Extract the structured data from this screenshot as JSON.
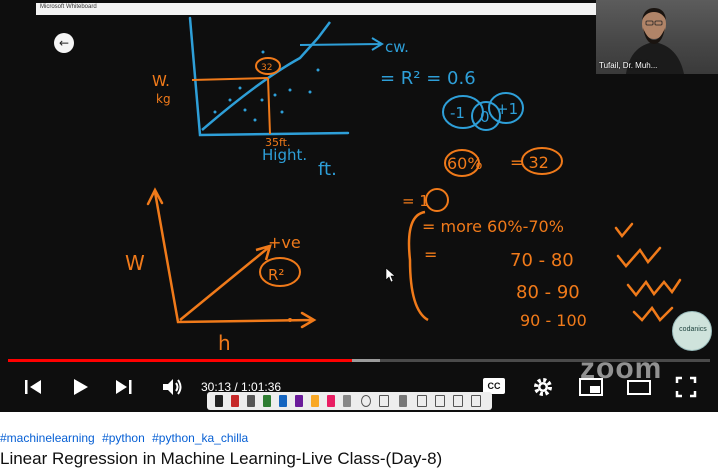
{
  "whiteboard": {
    "window_title": "Microsoft Whiteboard",
    "annotations": {
      "graph1_y_label": "W.",
      "graph1_y_unit": "kg",
      "point_label": "32",
      "x_mark": "35ft.",
      "x_label": "Hight.",
      "x_unit": "ft.",
      "arrow_label": "cw.",
      "r2_equation": "= R² = 0.6",
      "range_neg": "-1",
      "range_zero": "0",
      "range_pos": "+1",
      "percent": "60%",
      "percent_value": "= 32",
      "eq_marker": "= 1",
      "more_line": "= more 60%-70%",
      "row_70": "70 - 80",
      "row_80": "80 - 90",
      "row_90": "90 - 100",
      "graph2_y_label": "W",
      "graph2_x_label": "h",
      "trend_label": "+ve",
      "r2_short": "R²"
    }
  },
  "webcam": {
    "participant_name": "Tufail, Dr. Muh..."
  },
  "watermark": {
    "zoom": "zoom",
    "logo_text": "codanics"
  },
  "player": {
    "current_time": "30:13",
    "duration": "1:01:36",
    "time_display": "30:13 / 1:01:36",
    "progress_fraction": 0.49,
    "buffer_fraction": 0.53,
    "cc_label": "CC",
    "accent_color": "#ff0000"
  },
  "video": {
    "hashtags": [
      "#machinelearning",
      "#python",
      "#python_ka_chilla"
    ],
    "title": "Linear Regression in Machine Learning-Live Class-(Day-8)"
  }
}
